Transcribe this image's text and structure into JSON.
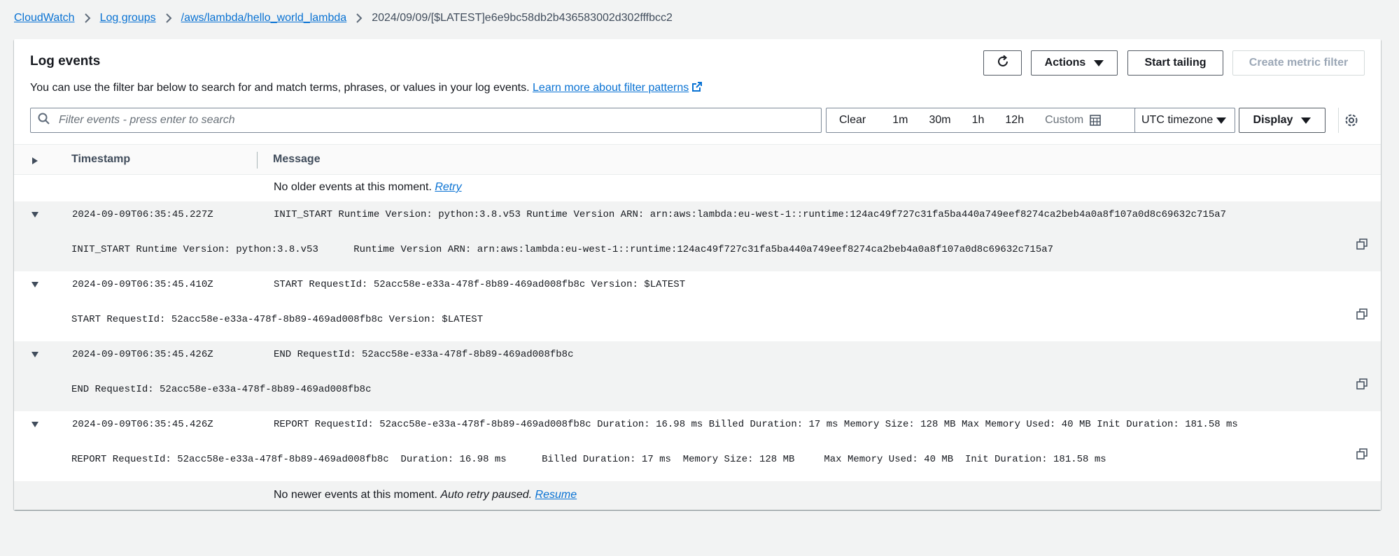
{
  "breadcrumb": {
    "items": [
      "CloudWatch",
      "Log groups",
      "/aws/lambda/hello_world_lambda"
    ],
    "current": "2024/09/09/[$LATEST]e6e9bc58db2b436583002d302fffbcc2"
  },
  "panel": {
    "title": "Log events",
    "description": "You can use the filter bar below to search for and match terms, phrases, or values in your log events.",
    "learn_more": "Learn more about filter patterns"
  },
  "toolbar": {
    "refresh_icon": "refresh-icon",
    "actions_label": "Actions",
    "tailing_label": "Start tailing",
    "metric_filter_label": "Create metric filter"
  },
  "search": {
    "placeholder": "Filter events - press enter to search",
    "value": ""
  },
  "time_range": {
    "items": [
      "Clear",
      "1m",
      "30m",
      "1h",
      "12h"
    ],
    "custom_label": "Custom"
  },
  "timezone": {
    "selected": "UTC timezone"
  },
  "display_label": "Display",
  "table": {
    "columns": [
      "Timestamp",
      "Message"
    ]
  },
  "older_notice": {
    "text": "No older events at this moment.",
    "link": "Retry"
  },
  "newer_notice": {
    "text": "No newer events at this moment.",
    "paused": "Auto retry paused.",
    "link": "Resume"
  },
  "events": [
    {
      "timestamp": "2024-09-09T06:35:45.227Z",
      "message": "INIT_START Runtime Version: python:3.8.v53 Runtime Version ARN: arn:aws:lambda:eu-west-1::runtime:124ac49f727c31fa5ba440a749eef8274ca2beb4a0a8f107a0d8c69632c715a7",
      "detail": "INIT_START Runtime Version: python:3.8.v53      Runtime Version ARN: arn:aws:lambda:eu-west-1::runtime:124ac49f727c31fa5ba440a749eef8274ca2beb4a0a8f107a0d8c69632c715a7"
    },
    {
      "timestamp": "2024-09-09T06:35:45.410Z",
      "message": "START RequestId: 52acc58e-e33a-478f-8b89-469ad008fb8c Version: $LATEST",
      "detail": "START RequestId: 52acc58e-e33a-478f-8b89-469ad008fb8c Version: $LATEST"
    },
    {
      "timestamp": "2024-09-09T06:35:45.426Z",
      "message": "END RequestId: 52acc58e-e33a-478f-8b89-469ad008fb8c",
      "detail": "END RequestId: 52acc58e-e33a-478f-8b89-469ad008fb8c"
    },
    {
      "timestamp": "2024-09-09T06:35:45.426Z",
      "message": "REPORT RequestId: 52acc58e-e33a-478f-8b89-469ad008fb8c Duration: 16.98 ms Billed Duration: 17 ms Memory Size: 128 MB Max Memory Used: 40 MB Init Duration: 181.58 ms",
      "detail": "REPORT RequestId: 52acc58e-e33a-478f-8b89-469ad008fb8c  Duration: 16.98 ms      Billed Duration: 17 ms  Memory Size: 128 MB     Max Memory Used: 40 MB  Init Duration: 181.58 ms"
    }
  ],
  "colors": {
    "link": "#0972d3",
    "shaded_row": "#f2f3f3",
    "page_bg": "#f2f3f3"
  }
}
